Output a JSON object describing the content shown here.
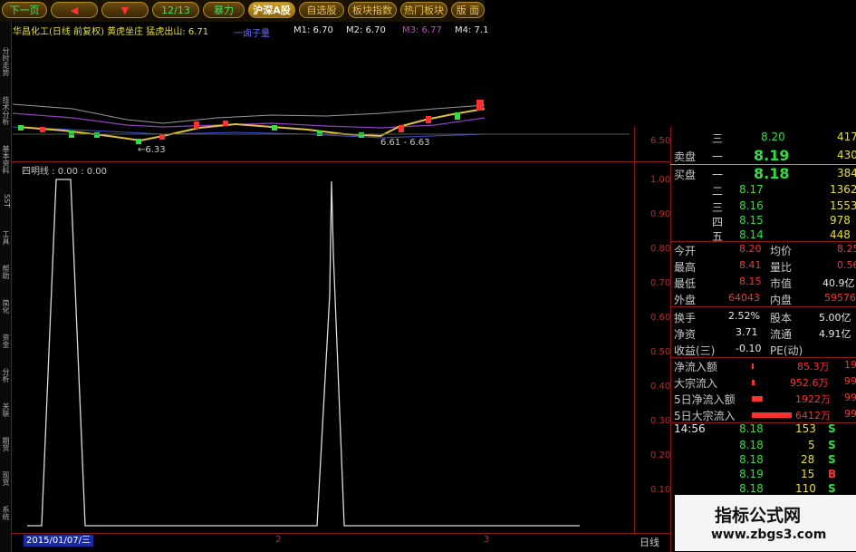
{
  "toolbar": {
    "buttons": [
      {
        "label": "下一页"
      },
      {
        "label": "◀"
      },
      {
        "label": "▼"
      },
      {
        "label": "12/13"
      },
      {
        "label": "暴力"
      },
      {
        "label": "沪深A股"
      },
      {
        "label": "自选股"
      },
      {
        "label": "板块指数"
      },
      {
        "label": "热门板块"
      },
      {
        "label": "版 面"
      }
    ]
  },
  "left_tabs": [
    "分时走势",
    "技术分析",
    "基本资料",
    "SST",
    "工具",
    "帮助",
    "简化",
    "资金",
    "分析",
    "关联",
    "期货",
    "现货",
    "系统"
  ],
  "chart_info": {
    "title": "华昌化工(日线 前复权) 黄虎坐庄  猛虎出山: 6.71",
    "legend_zero": "一卤子量",
    "m1": "M1: 6.70",
    "m2": "M2: 6.70",
    "m3": "M3: 6.77",
    "m4": "M4: 7.1"
  },
  "price_panel": {
    "low_label": "←6.33",
    "range_label": "6.61 - 6.63",
    "axis_value": "6.50"
  },
  "indicator_panel": {
    "title": "四明线 : 0.00 : 0.00",
    "axis": [
      "1.00",
      "0.90",
      "0.80",
      "0.70",
      "0.60",
      "0.50",
      "0.40",
      "0.30",
      "0.20",
      "0.10"
    ]
  },
  "bottom_bar": {
    "date": "2015/01/07/三",
    "marks": [
      "2",
      "3"
    ],
    "period": "日线"
  },
  "orderbook": {
    "sell": [
      {
        "level": "三",
        "price": "8.20",
        "vol": "417"
      },
      {
        "level": "一",
        "price": "8.19",
        "vol": "430"
      }
    ],
    "sell_label": "卖盘",
    "buy_label": "买盘",
    "buy": [
      {
        "level": "一",
        "price": "8.18",
        "vol": "384"
      },
      {
        "level": "二",
        "price": "8.17",
        "vol": "1362"
      },
      {
        "level": "三",
        "price": "8.16",
        "vol": "1553"
      },
      {
        "level": "四",
        "price": "8.15",
        "vol": "978"
      },
      {
        "level": "五",
        "price": "8.14",
        "vol": "448"
      }
    ]
  },
  "stats": [
    {
      "l1": "今开",
      "v1": "8.20",
      "l2": "均价",
      "v2": "8.25"
    },
    {
      "l1": "最高",
      "v1": "8.41",
      "l2": "量比",
      "v2": "0.56"
    },
    {
      "l1": "最低",
      "v1": "8.15",
      "l2": "市值",
      "v2": "40.9亿"
    },
    {
      "l1": "外盘",
      "v1": "64043",
      "l2": "内盘",
      "v2": "59576"
    },
    {
      "l1": "换手",
      "v1": "2.52%",
      "l2": "股本",
      "v2": "5.00亿"
    },
    {
      "l1": "净资",
      "v1": "3.71",
      "l2": "流通",
      "v2": "4.91亿"
    },
    {
      "l1": "收益(三)",
      "v1": "-0.10",
      "l2": "PE(动)",
      "v2": ""
    }
  ],
  "flows": [
    {
      "label": "净流入额",
      "value": "85.3万",
      "tail": "19",
      "bar": 0.02
    },
    {
      "label": "大宗流入",
      "value": "952.6万",
      "tail": "99",
      "bar": 0.04
    },
    {
      "label": "5日净流入额",
      "value": "1922万",
      "tail": "99",
      "bar": 0.15
    },
    {
      "label": "5日大宗流入",
      "value": "6412万",
      "tail": "99",
      "bar": 0.55
    }
  ],
  "ticks": [
    {
      "time": "14:56",
      "price": "8.18",
      "vol": "153",
      "side": "S"
    },
    {
      "time": "",
      "price": "8.18",
      "vol": "5",
      "side": "S"
    },
    {
      "time": "",
      "price": "8.18",
      "vol": "28",
      "side": "S"
    },
    {
      "time": "",
      "price": "8.19",
      "vol": "15",
      "side": "B"
    },
    {
      "time": "",
      "price": "8.18",
      "vol": "110",
      "side": "S"
    }
  ],
  "watermark": {
    "title": "指标公式网",
    "url": "www.zbgs3.com"
  }
}
